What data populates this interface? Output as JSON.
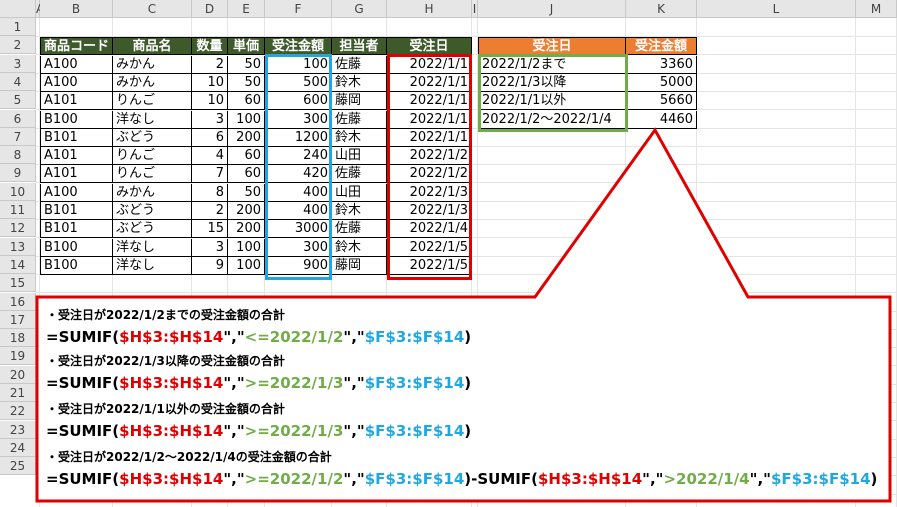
{
  "columns": [
    "A",
    "B",
    "C",
    "D",
    "E",
    "F",
    "G",
    "H",
    "I",
    "J",
    "K",
    "L",
    "M"
  ],
  "rows": [
    "1",
    "2",
    "3",
    "4",
    "5",
    "6",
    "7",
    "8",
    "9",
    "10",
    "11",
    "12",
    "13",
    "14",
    "15",
    "16",
    "17",
    "18",
    "19",
    "20",
    "21",
    "22",
    "23",
    "24",
    "25"
  ],
  "table": {
    "headers": [
      "商品コード",
      "商品名",
      "数量",
      "単価",
      "受注金額",
      "担当者",
      "受注日"
    ],
    "rows": [
      [
        "A100",
        "みかん",
        "2",
        "50",
        "100",
        "佐藤",
        "2022/1/1"
      ],
      [
        "A100",
        "みかん",
        "10",
        "50",
        "500",
        "鈴木",
        "2022/1/1"
      ],
      [
        "A101",
        "りんご",
        "10",
        "60",
        "600",
        "藤岡",
        "2022/1/1"
      ],
      [
        "B100",
        "洋なし",
        "3",
        "100",
        "300",
        "佐藤",
        "2022/1/1"
      ],
      [
        "B101",
        "ぶどう",
        "6",
        "200",
        "1200",
        "鈴木",
        "2022/1/1"
      ],
      [
        "A101",
        "りんご",
        "4",
        "60",
        "240",
        "山田",
        "2022/1/2"
      ],
      [
        "A101",
        "りんご",
        "7",
        "60",
        "420",
        "佐藤",
        "2022/1/2"
      ],
      [
        "A100",
        "みかん",
        "8",
        "50",
        "400",
        "山田",
        "2022/1/3"
      ],
      [
        "B101",
        "ぶどう",
        "2",
        "200",
        "400",
        "鈴木",
        "2022/1/3"
      ],
      [
        "B101",
        "ぶどう",
        "15",
        "200",
        "3000",
        "佐藤",
        "2022/1/4"
      ],
      [
        "B100",
        "洋なし",
        "3",
        "100",
        "300",
        "鈴木",
        "2022/1/5"
      ],
      [
        "B100",
        "洋なし",
        "9",
        "100",
        "900",
        "藤岡",
        "2022/1/5"
      ]
    ]
  },
  "summary": {
    "headers": [
      "受注日",
      "受注金額"
    ],
    "rows": [
      [
        "2022/1/2まで",
        "3360"
      ],
      [
        "2022/1/3以降",
        "5000"
      ],
      [
        "2022/1/1以外",
        "5660"
      ],
      [
        "2022/1/2～2022/1/4",
        "4460"
      ]
    ]
  },
  "notes": [
    {
      "title": "・受注日が2022/1/2までの受注金額の合計",
      "parts": [
        "=SUMIF(",
        "$H$3:$H$14",
        "\",\"",
        "<=2022/1/2",
        "\",\"",
        "$F$3:$F$14",
        ")"
      ]
    },
    {
      "title": "・受注日が2022/1/3以降の受注金額の合計",
      "parts": [
        "=SUMIF(",
        "$H$3:$H$14",
        "\",\"",
        ">=2022/1/3",
        "\",\"",
        "$F$3:$F$14",
        ")"
      ]
    },
    {
      "title": "・受注日が2022/1/1以外の受注金額の合計",
      "parts": [
        "=SUMIF(",
        "$H$3:$H$14",
        "\",\"",
        ">=2022/1/3",
        "\",\"",
        "$F$3:$F$14",
        ")"
      ]
    },
    {
      "title": "・受注日が2022/1/2～2022/1/4の受注金額の合計",
      "parts": [
        "=SUMIF(",
        "$H$3:$H$14",
        "\",\"",
        ">=2022/1/2",
        "\",\"",
        "$F$3:$F$14",
        ")-SUMIF(",
        "$H$3:$H$14",
        "\",\"",
        ">2022/1/4",
        "\",\"",
        "$F$3:$F$14",
        ")"
      ]
    }
  ],
  "colors": {
    "header_bg": "#3e5a2a",
    "accent_orange": "#ed7d31",
    "frame_blue": "#1fa8e0",
    "frame_red": "#e00000",
    "frame_green": "#70ad47"
  }
}
